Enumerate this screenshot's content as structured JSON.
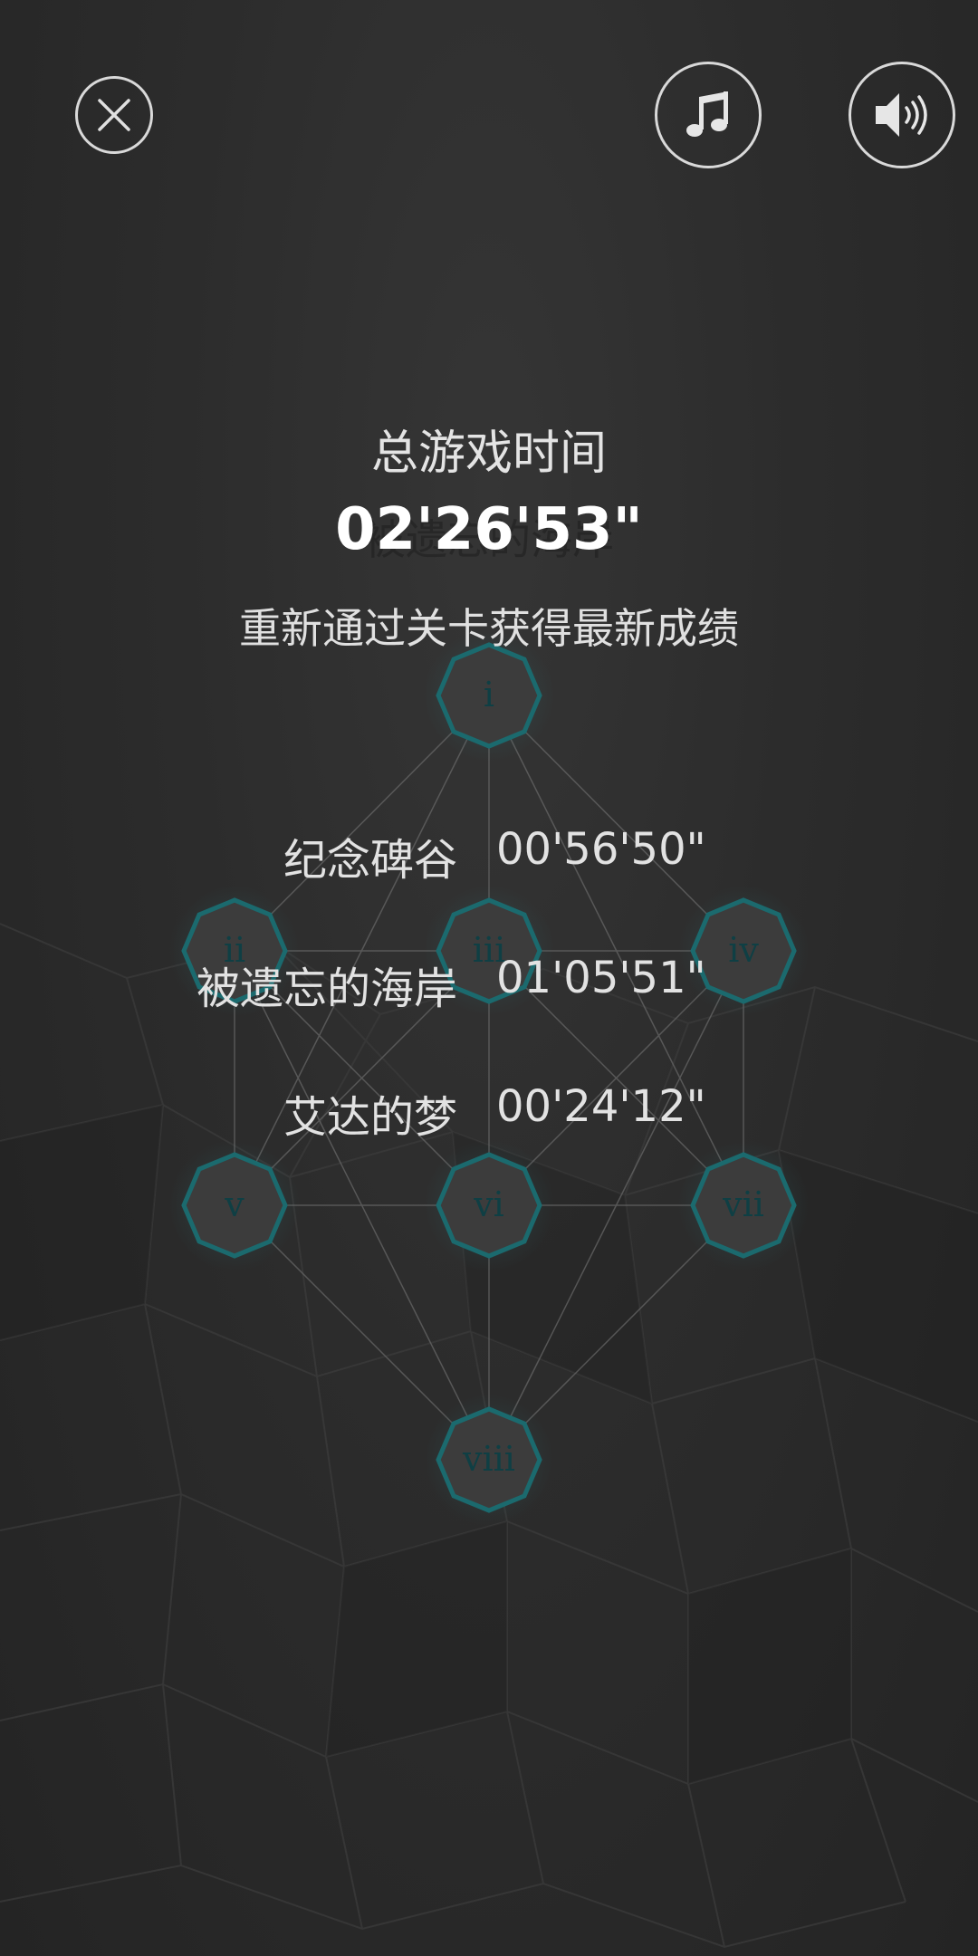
{
  "controls": {
    "close_icon": "close-icon",
    "music_icon": "music-note-icon",
    "sound_icon": "speaker-icon"
  },
  "summary": {
    "title": "总游戏时间",
    "total_time": "02'26'53\"",
    "ghost_text": "被遗忘的海岸",
    "hint": "重新通过关卡获得最新成绩"
  },
  "scores": [
    {
      "name": "纪念碑谷",
      "time": "00'56'50\""
    },
    {
      "name": "被遗忘的海岸",
      "time": "01'05'51\""
    },
    {
      "name": "艾达的梦",
      "time": "00'24'12\""
    }
  ],
  "chapters": [
    {
      "label": "i"
    },
    {
      "label": "ii"
    },
    {
      "label": "iii"
    },
    {
      "label": "iv"
    },
    {
      "label": "v"
    },
    {
      "label": "vi"
    },
    {
      "label": "vii"
    },
    {
      "label": "viii"
    }
  ],
  "colors": {
    "node_fill": "#3d3d3d",
    "node_border": "#1c6b6f",
    "node_label": "#0f3f44",
    "connector": "#6a6a6a"
  }
}
